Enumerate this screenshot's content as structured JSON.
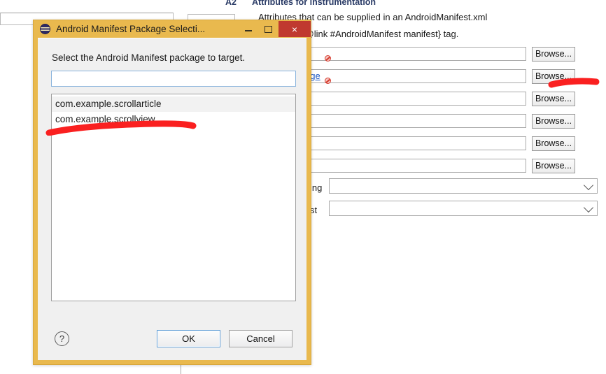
{
  "background": {
    "section_header": "Attributes for instrumentation",
    "section_badge": "A2",
    "doc_line_1": "Attributes that can be supplied in an AndroidManifest.xml",
    "doc_line_2": "of the root {@link #AndroidManifest manifest} tag.",
    "link_label": "age",
    "browse_label": "Browse...",
    "rows": [
      {
        "value": "",
        "has_error": true,
        "has_link": false
      },
      {
        "value": "",
        "has_error": true,
        "has_link": true
      },
      {
        "value": "",
        "has_error": false,
        "has_link": false
      },
      {
        "value": "",
        "has_error": false,
        "has_link": false
      },
      {
        "value": "",
        "has_error": false,
        "has_link": false
      },
      {
        "value": "",
        "has_error": false,
        "has_link": false
      }
    ],
    "combo_rows": [
      {
        "label": "ing",
        "value": ""
      },
      {
        "label": "st",
        "value": ""
      }
    ]
  },
  "dialog": {
    "title": "Android Manifest Package Selecti...",
    "icon": "eclipse-icon",
    "window_buttons": {
      "minimize": "minimize-icon",
      "maximize": "maximize-icon",
      "close": "×"
    },
    "prompt": "Select the Android Manifest package to target.",
    "filter": {
      "value": "",
      "placeholder": ""
    },
    "list": {
      "items": [
        {
          "label": "com.example.scrollarticle",
          "selected": true
        },
        {
          "label": "com.example.scrollview",
          "selected": false
        }
      ]
    },
    "help_glyph": "?",
    "ok_label": "OK",
    "cancel_label": "Cancel"
  },
  "colors": {
    "dialog_frame": "#e9b94e",
    "dialog_body": "#f0f0f0",
    "close_button": "#c0392f",
    "focus_border": "#5f9dd6",
    "link": "#1a57c4",
    "annotation": "#fa2020",
    "error": "#d63c2f"
  },
  "annotations": [
    {
      "name": "list-underline-mark",
      "color": "#fa2020"
    },
    {
      "name": "browse-underline-mark",
      "color": "#fa2020"
    }
  ]
}
